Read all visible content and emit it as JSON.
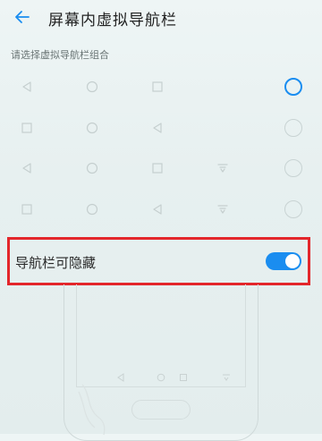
{
  "header": {
    "title": "屏幕内虚拟导航栏",
    "back_icon": "back-arrow-icon"
  },
  "section": {
    "label": "请选择虚拟导航栏组合"
  },
  "nav_options": [
    {
      "buttons": [
        "back",
        "home",
        "recent"
      ],
      "selected": true
    },
    {
      "buttons": [
        "recent",
        "home",
        "back"
      ],
      "selected": false
    },
    {
      "buttons": [
        "back",
        "home",
        "recent",
        "notification"
      ],
      "selected": false
    },
    {
      "buttons": [
        "recent",
        "home",
        "back",
        "notification"
      ],
      "selected": false
    }
  ],
  "toggle": {
    "label": "导航栏可隐藏",
    "state": "on"
  },
  "colors": {
    "accent": "#1a8df0",
    "highlight_border": "#e3262b",
    "icon_gray": "#c5cfcf"
  }
}
